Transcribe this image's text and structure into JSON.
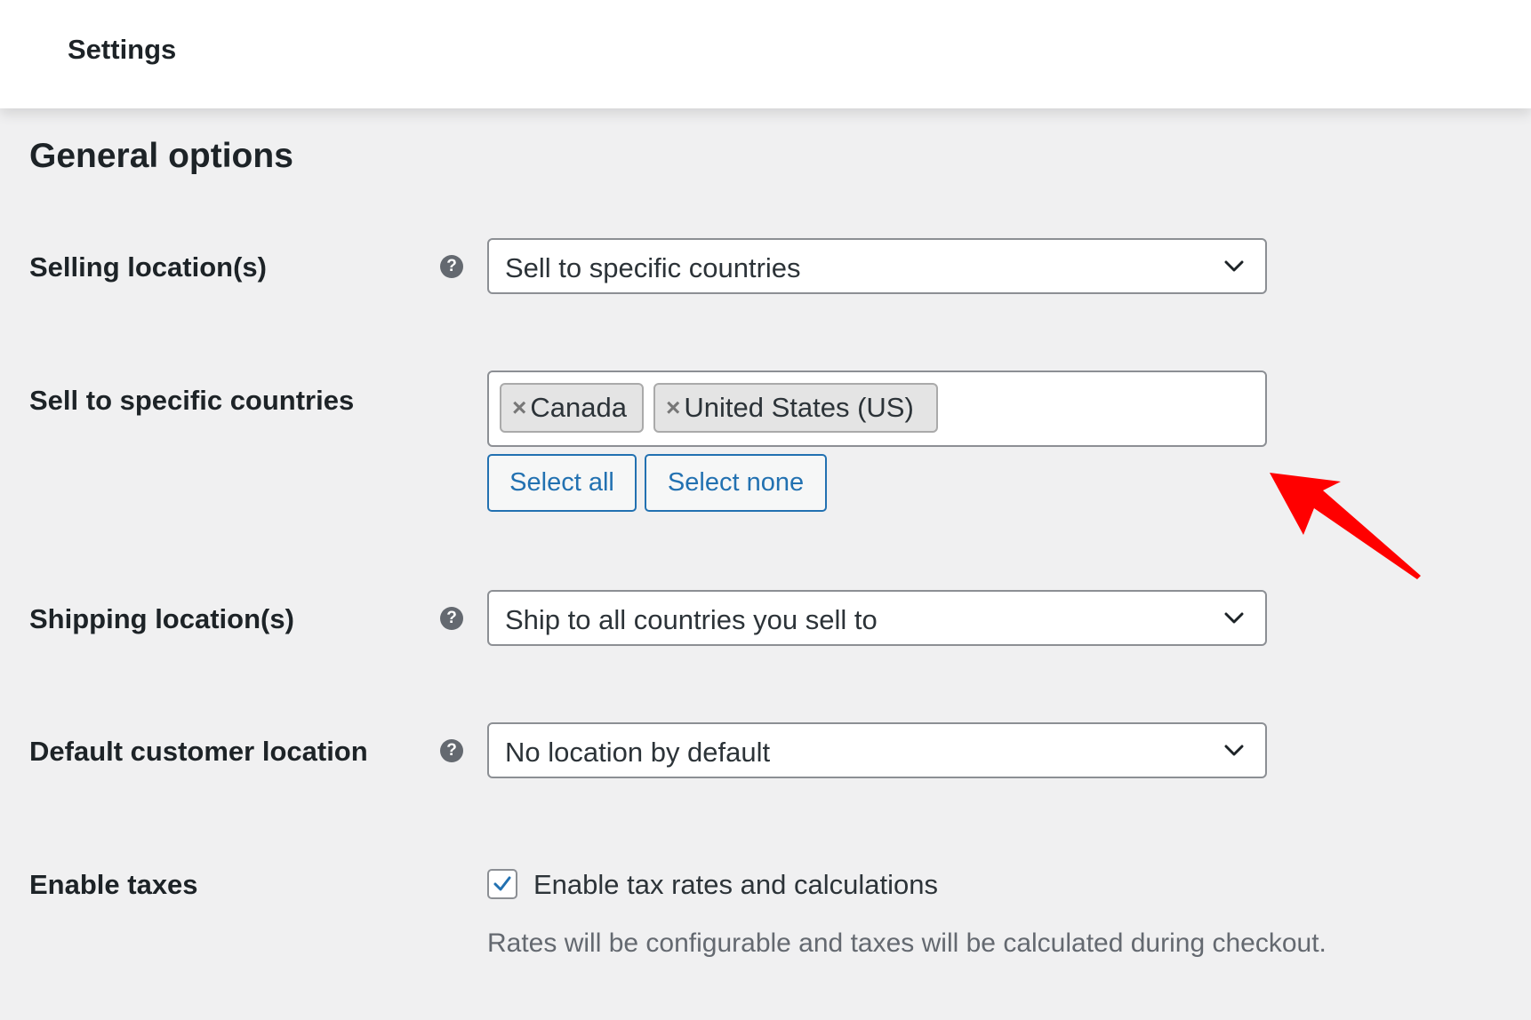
{
  "header": {
    "title": "Settings"
  },
  "section": {
    "title": "General options"
  },
  "selling_location": {
    "label": "Selling location(s)",
    "help_icon": "question-circle-icon",
    "value": "Sell to specific countries"
  },
  "specific_countries": {
    "label": "Sell to specific countries",
    "tags": [
      {
        "remove": "×",
        "label": "Canada"
      },
      {
        "remove": "×",
        "label": "United States (US)"
      }
    ],
    "select_all_label": "Select all",
    "select_none_label": "Select none"
  },
  "shipping_location": {
    "label": "Shipping location(s)",
    "help_icon": "question-circle-icon",
    "value": "Ship to all countries you sell to"
  },
  "default_customer_location": {
    "label": "Default customer location",
    "help_icon": "question-circle-icon",
    "value": "No location by default"
  },
  "enable_taxes": {
    "label": "Enable taxes",
    "checked": true,
    "checkbox_label": "Enable tax rates and calculations",
    "description": "Rates will be configurable and taxes will be calculated during checkout."
  },
  "annotation": {
    "arrow_icon": "red-arrow-icon",
    "color": "#ff0000"
  },
  "colors": {
    "accent": "#2271b1",
    "background": "#f0f0f1",
    "text": "#1d2327"
  }
}
